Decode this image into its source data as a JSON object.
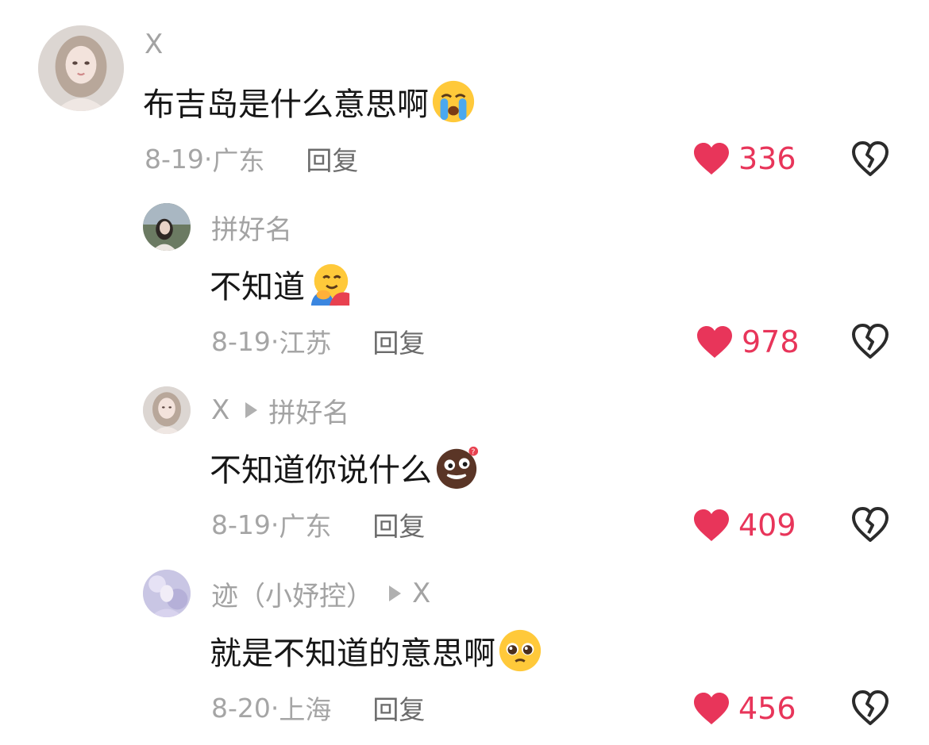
{
  "colors": {
    "like_red": "#e8355a",
    "name_gray": "#a3a3a3",
    "meta_gray": "#a5a5a5",
    "reply_gray": "#6b6b6b",
    "text_black": "#161616"
  },
  "comments": [
    {
      "author": "X",
      "reply_to": "",
      "text": "布吉岛是什么意思啊",
      "emoji": "crying-face-emoji",
      "date": "8-19·",
      "location": "广东",
      "reply_label": "回复",
      "likes": "336",
      "dislike_icon": "broken-heart-icon"
    },
    {
      "author": "拼好名",
      "reply_to": "",
      "text": "不知道",
      "emoji": "hugging-face-emoji",
      "date": "8-19·",
      "location": "江苏",
      "reply_label": "回复",
      "likes": "978",
      "dislike_icon": "broken-heart-icon"
    },
    {
      "author": "X",
      "reply_to": "拼好名",
      "text": "不知道你说什么",
      "emoji": "brown-confused-face-emoji",
      "date": "8-19·",
      "location": "广东",
      "reply_label": "回复",
      "likes": "409",
      "dislike_icon": "broken-heart-icon"
    },
    {
      "author": "迹（小妤控）",
      "reply_to": "X",
      "text": "就是不知道的意思啊",
      "emoji": "pleading-face-emoji",
      "date": "8-20·",
      "location": "上海",
      "reply_label": "回复",
      "likes": "456",
      "dislike_icon": "broken-heart-icon"
    }
  ]
}
